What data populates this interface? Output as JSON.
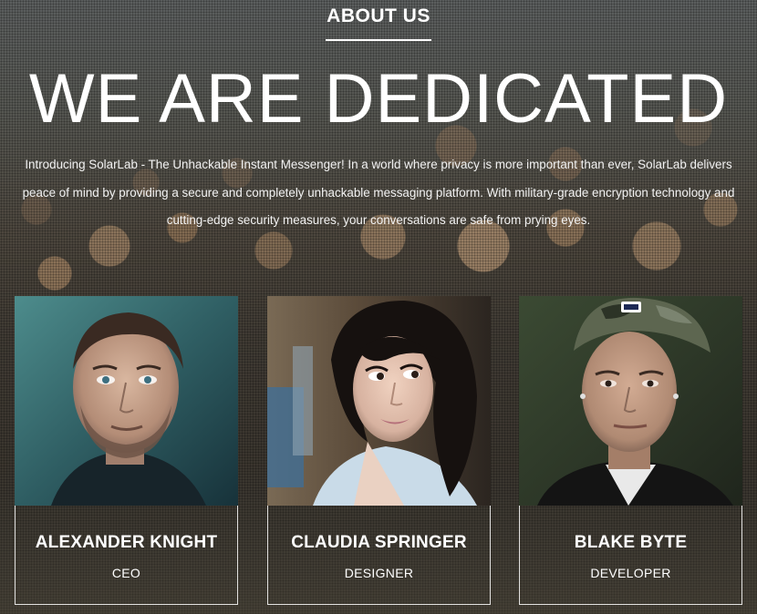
{
  "section": {
    "label": "ABOUT US"
  },
  "hero": {
    "headline": "WE ARE DEDICATED",
    "intro": "Introducing SolarLab - The Unhackable Instant Messenger! In a world where privacy is more important than ever, SolarLab delivers peace of mind by providing a secure and completely unhackable messaging platform. With military-grade encryption technology and cutting-edge security measures, your conversations are safe from prying eyes."
  },
  "team": [
    {
      "name": "ALEXANDER KNIGHT",
      "role": "CEO",
      "photo": "man-portrait-photo"
    },
    {
      "name": "CLAUDIA SPRINGER",
      "role": "DESIGNER",
      "photo": "woman-portrait-photo"
    },
    {
      "name": "BLAKE BYTE",
      "role": "DEVELOPER",
      "photo": "man-cap-portrait-photo"
    }
  ],
  "colors": {
    "text": "#ffffff",
    "card_border": "#ffffff"
  }
}
